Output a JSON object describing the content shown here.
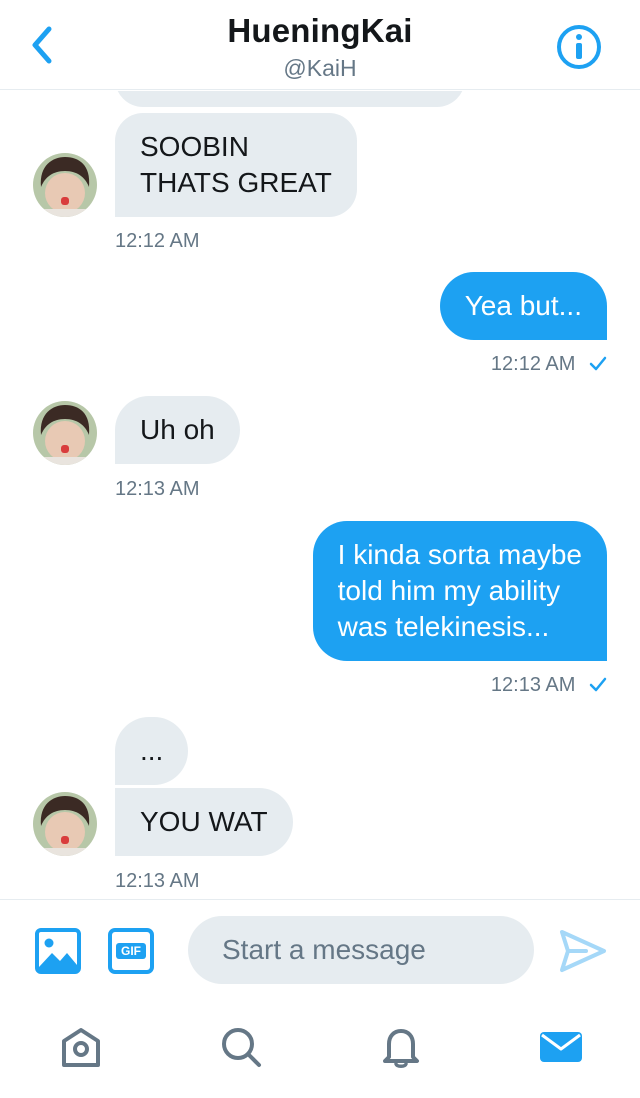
{
  "header": {
    "title": "HueningKai",
    "handle": "@KaiH"
  },
  "messages": [
    {
      "side": "in",
      "text_lines": [
        "SOOBIN",
        "THATS GREAT"
      ],
      "time": "12:12 AM"
    },
    {
      "side": "out",
      "text_lines": [
        "Yea but..."
      ],
      "time": "12:12 AM",
      "read": true
    },
    {
      "side": "in",
      "text_lines": [
        "Uh oh"
      ],
      "time": "12:13 AM"
    },
    {
      "side": "out",
      "text_lines": [
        "I kinda sorta maybe",
        "told him my ability",
        "was telekinesis..."
      ],
      "time": "12:13 AM",
      "read": true
    },
    {
      "side": "in",
      "text_lines": [
        "..."
      ]
    },
    {
      "side": "in",
      "text_lines": [
        "YOU WAT"
      ],
      "time": "12:13 AM"
    }
  ],
  "composer": {
    "placeholder": "Start a message",
    "gif_label": "GIF"
  },
  "icons": {
    "back": "chevron-left-icon",
    "info": "info-icon",
    "image": "image-icon",
    "gif": "gif-icon",
    "send": "send-icon",
    "home": "home-icon",
    "search": "search-icon",
    "notifications": "bell-icon",
    "messages": "envelope-icon"
  },
  "colors": {
    "accent": "#1da1f2",
    "incoming_bubble": "#e6ecf0",
    "secondary_text": "#657786"
  }
}
